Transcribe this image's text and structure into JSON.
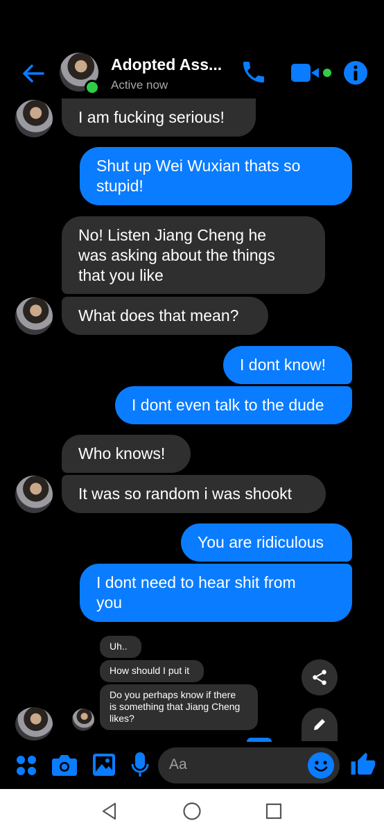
{
  "header": {
    "title": "Adopted Ass...",
    "status": "Active now",
    "icons": [
      "back-arrow-icon",
      "phone-icon",
      "video-camera-icon",
      "info-icon"
    ]
  },
  "messages": [
    {
      "side": "in",
      "text": "I am fucking serious!"
    },
    {
      "side": "out",
      "text": "Shut up Wei Wuxian thats so\nstupid!"
    },
    {
      "side": "in",
      "text": "No! Listen Jiang Cheng he\nwas asking about the things\nthat you like"
    },
    {
      "side": "in",
      "text": "What does that mean?"
    },
    {
      "side": "out",
      "text": "I dont know!"
    },
    {
      "side": "out",
      "text": "I dont even talk to the dude"
    },
    {
      "side": "in",
      "text": "Who knows!"
    },
    {
      "side": "in",
      "text": "It was so random i was shookt"
    },
    {
      "side": "out",
      "text": "You are ridiculous"
    },
    {
      "side": "out",
      "text": "I dont need to hear shit from\nyou"
    }
  ],
  "shared_media": {
    "messages": [
      "Uh..",
      "How should I put it",
      "Do you perhaps know if there\nis something that Jiang Cheng\nlikes?"
    ],
    "icons": [
      "share-icon",
      "pencil-icon"
    ]
  },
  "composer": {
    "placeholder": "Aa",
    "icons": [
      "apps-icon",
      "camera-icon",
      "gallery-icon",
      "microphone-icon",
      "emoji-icon",
      "thumbs-up-icon"
    ]
  },
  "navbar": {
    "icons": [
      "back-triangle-icon",
      "home-circle-icon",
      "recents-square-icon"
    ]
  },
  "colors": {
    "accent": "#0a7cff",
    "incoming_bubble": "#2f2f2f",
    "background": "#000000",
    "online": "#31cc46"
  }
}
